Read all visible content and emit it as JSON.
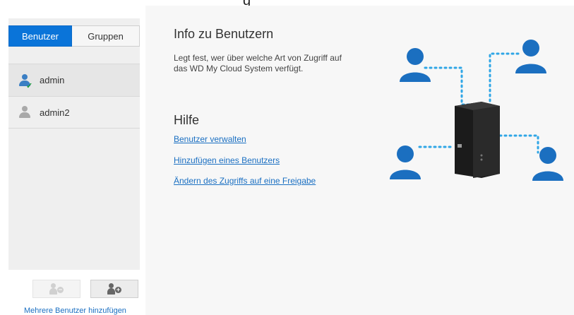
{
  "sidebar": {
    "tabs": [
      {
        "label": "Benutzer",
        "active": true
      },
      {
        "label": "Gruppen",
        "active": false
      }
    ],
    "users": [
      {
        "name": "admin",
        "icon": "user-admin-icon",
        "selected": true
      },
      {
        "name": "admin2",
        "icon": "user-icon",
        "selected": false
      }
    ],
    "add_multiple_label": "Mehrere Benutzer hinzufügen"
  },
  "main": {
    "info_title": "Info zu Benutzern",
    "info_text": "Legt fest, wer über welche Art von Zugriff auf das WD My Cloud System verfügt.",
    "help_title": "Hilfe",
    "help_links": [
      "Benutzer verwalten",
      "Hinzufügen eines Benutzers",
      "Ändern des Zugriffs auf eine Freigabe"
    ]
  },
  "colors": {
    "accent": "#0a74d9",
    "link": "#1a6fc2",
    "illustration_blue": "#1b6fc0",
    "illustration_dots": "#2fa6e6"
  }
}
